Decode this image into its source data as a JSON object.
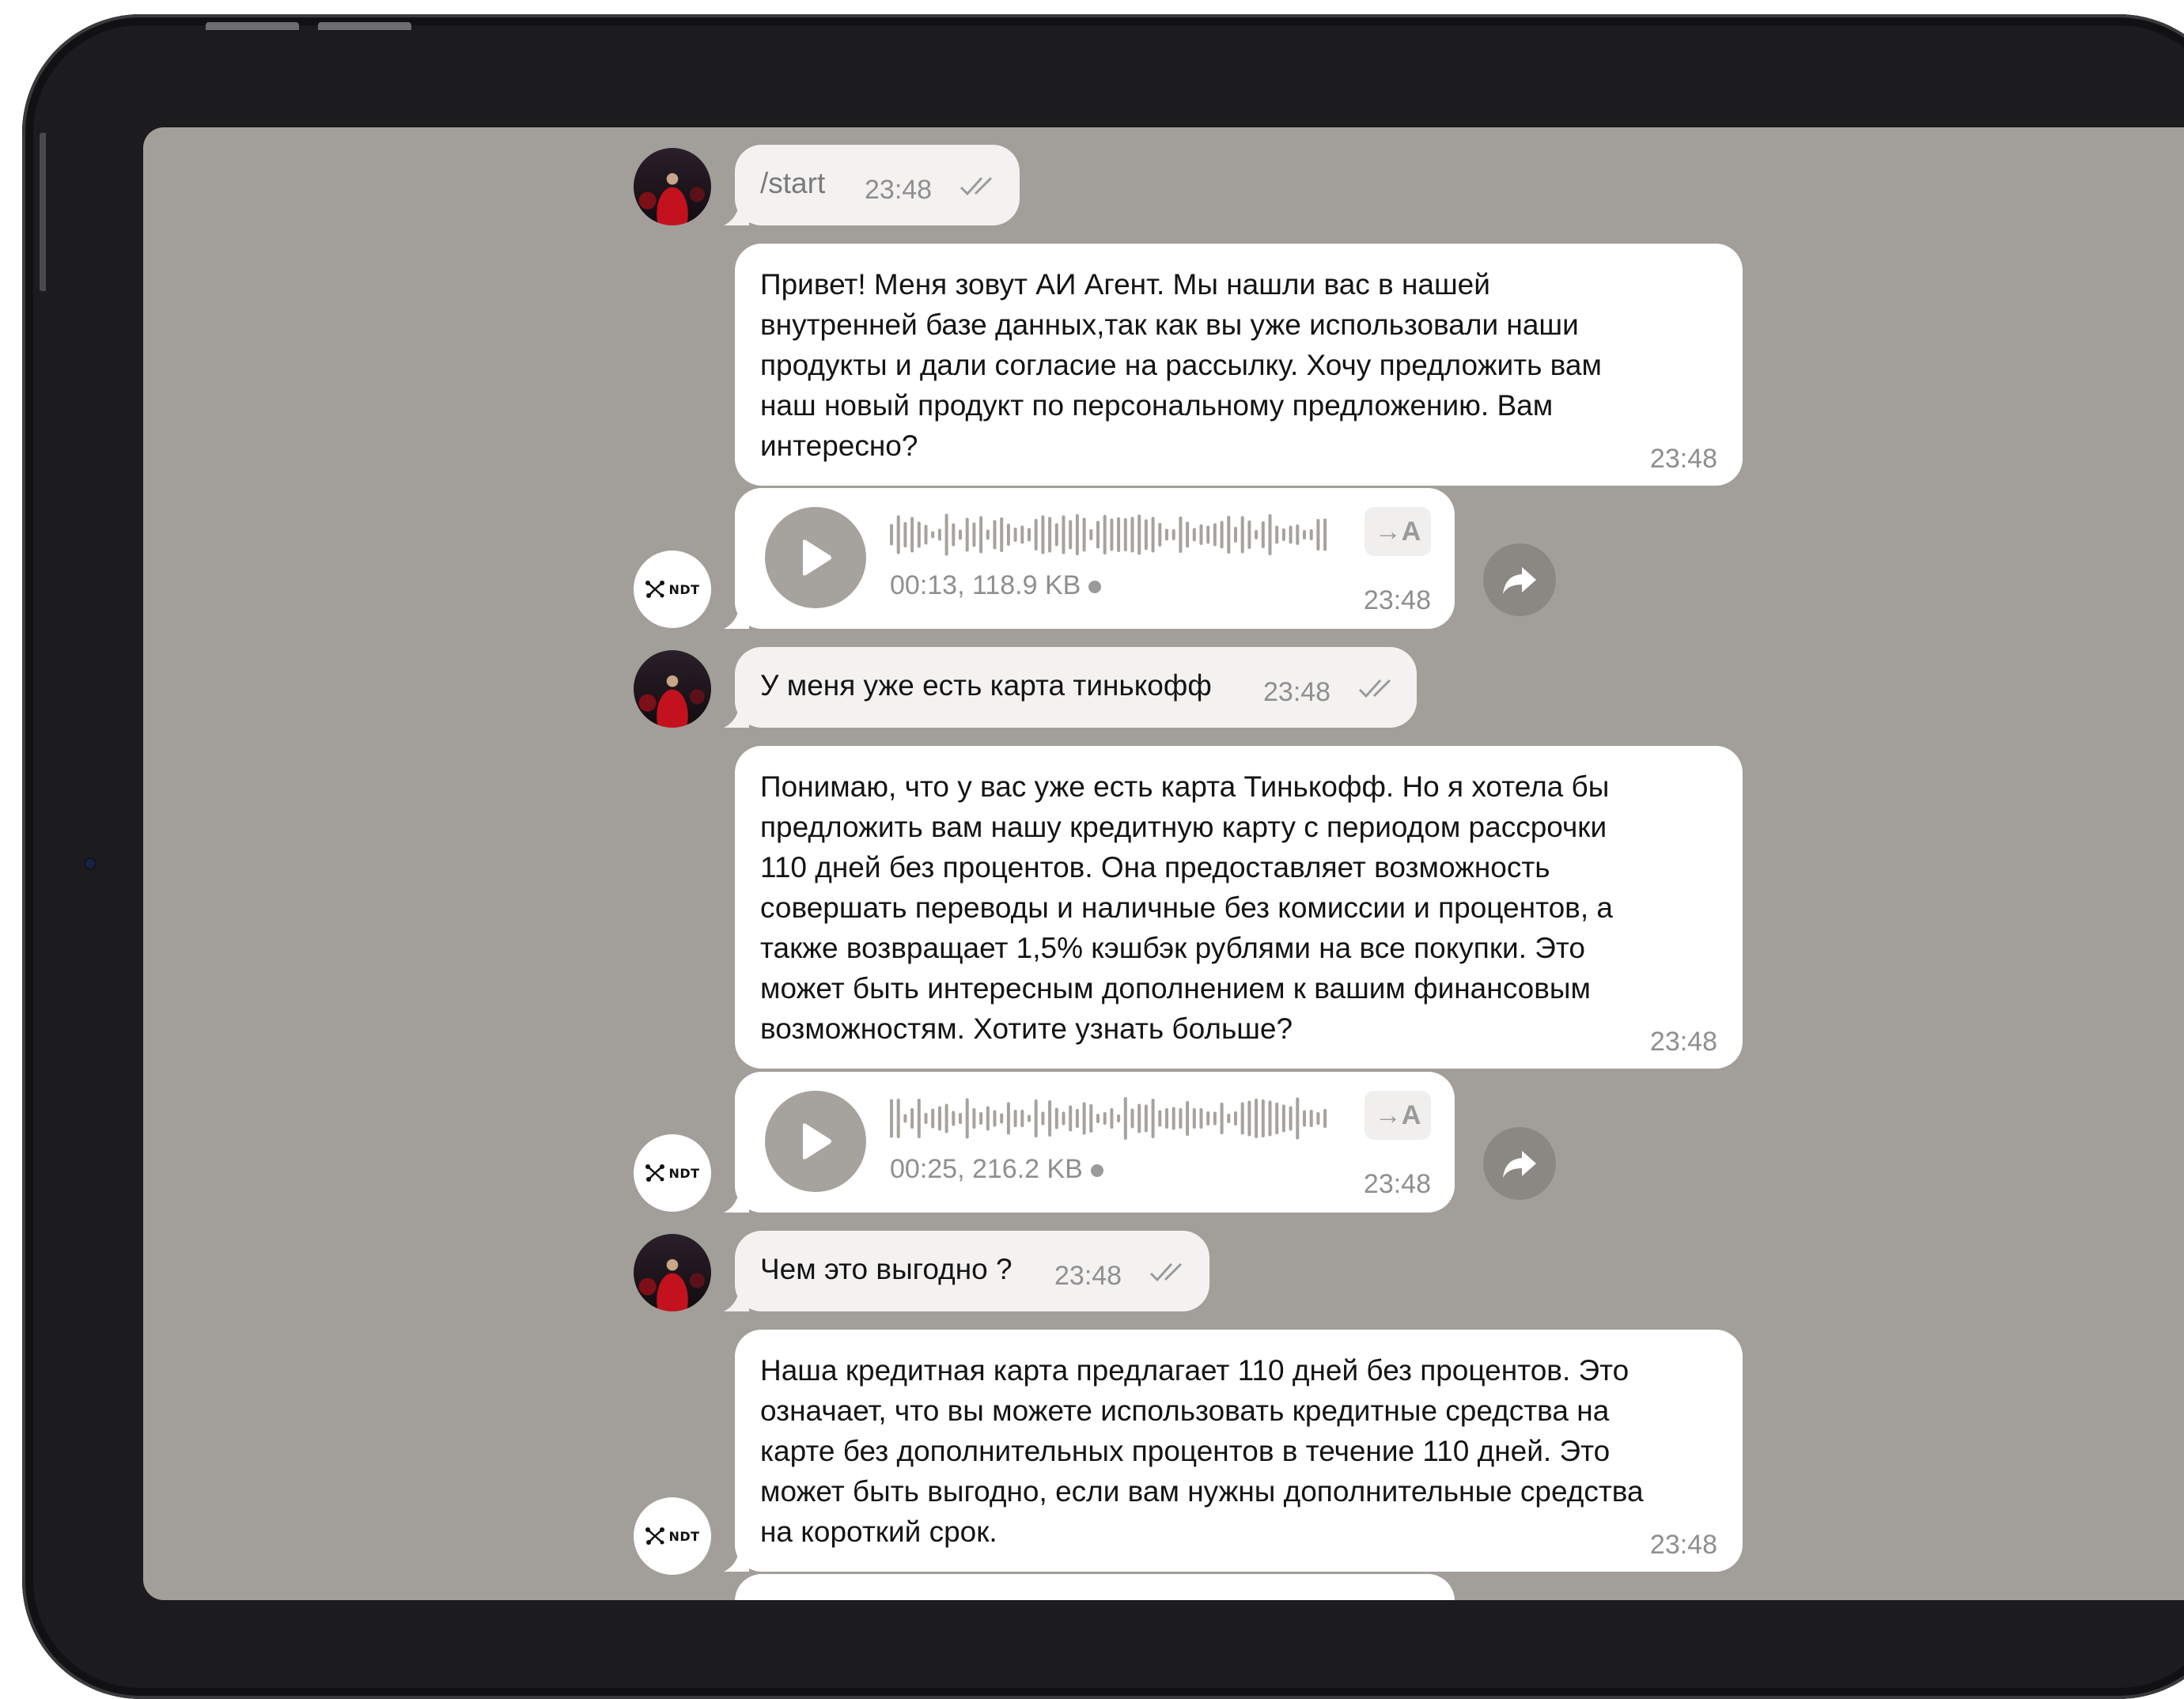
{
  "messages": [
    {
      "type": "sent",
      "text": "/start",
      "time": "23:48"
    },
    {
      "type": "received",
      "text": "Привет! Меня зовут АИ Агент. Мы нашли вас в нашей\nвнутренней базе данных,так как вы уже использовали наши\nпродукты и дали согласие на рассылку. Хочу предложить вам\nнаш новый продукт по персональному предложению. Вам\nинтересно?",
      "time": "23:48"
    },
    {
      "type": "voice",
      "transcribe_label": "→A",
      "meta": "00:13, 118.9 KB",
      "time": "23:48"
    },
    {
      "type": "sent",
      "text": "У меня уже есть карта тинькофф",
      "time": "23:48"
    },
    {
      "type": "received",
      "text": "Понимаю, что у вас уже есть карта Тинькофф. Но я хотела бы\nпредложить вам нашу кредитную карту с периодом рассрочки\n110 дней без процентов. Она предоставляет возможность\nсовершать переводы и наличные без комиссии и процентов, а\nтакже возвращает 1,5% кэшбэк рублями на все покупки. Это\nможет быть интересным дополнением к вашим финансовым\nвозможностям. Хотите узнать больше?",
      "time": "23:48"
    },
    {
      "type": "voice",
      "transcribe_label": "→A",
      "meta": "00:25, 216.2 KB",
      "time": "23:48"
    },
    {
      "type": "sent",
      "text": "Чем это выгодно ?",
      "time": "23:48"
    },
    {
      "type": "received",
      "text": "Наша кредитная карта предлагает 110 дней без процентов. Это\nозначает, что вы можете использовать кредитные средства на\nкарте без дополнительных процентов в течение 110 дней. Это\nможет быть выгодно, если вам нужны дополнительные средства\nна короткий срок.",
      "time": "23:48"
    }
  ],
  "bot_avatar_label": "NDT",
  "colors": {
    "chat_background": "#a29e99",
    "bubble": "#ffffff",
    "sent_bubble": "#f4f2f1",
    "device_frame": "#1c1c1e"
  }
}
